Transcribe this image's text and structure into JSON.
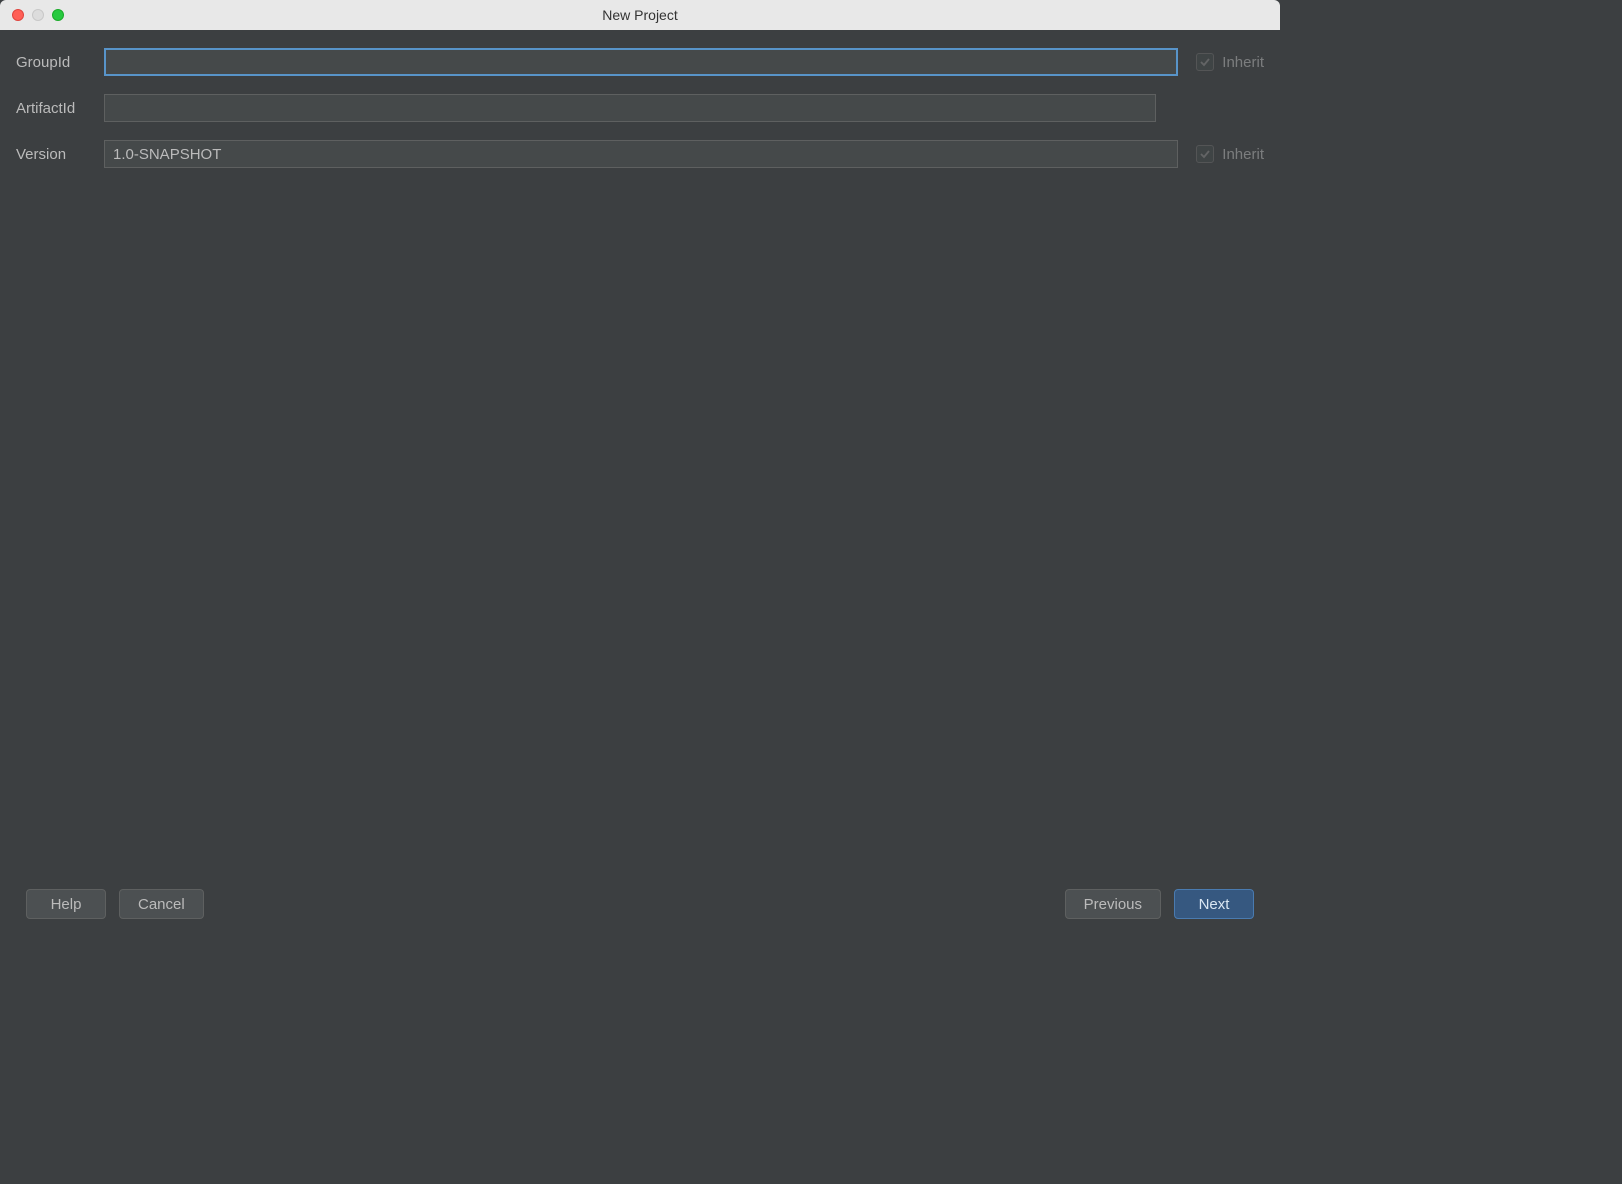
{
  "window": {
    "title": "New Project"
  },
  "form": {
    "groupId": {
      "label": "GroupId",
      "value": "",
      "inherit_label": "Inherit"
    },
    "artifactId": {
      "label": "ArtifactId",
      "value": ""
    },
    "version": {
      "label": "Version",
      "value": "1.0-SNAPSHOT",
      "inherit_label": "Inherit"
    }
  },
  "buttons": {
    "help": "Help",
    "cancel": "Cancel",
    "previous": "Previous",
    "next": "Next"
  }
}
